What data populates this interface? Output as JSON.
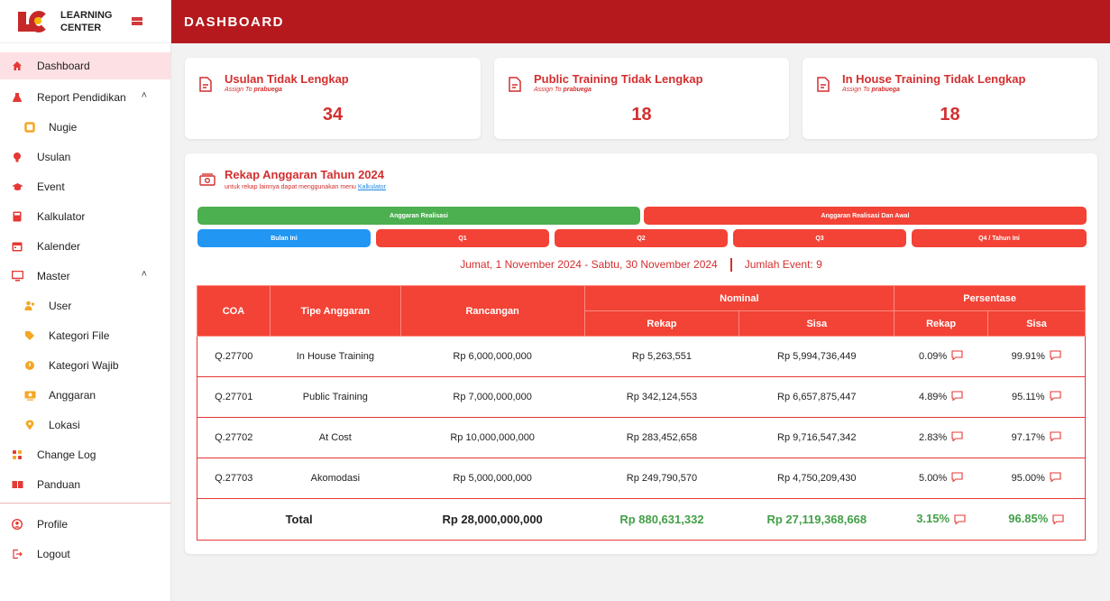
{
  "brand": {
    "line1": "LEARNING",
    "line2": "CENTER"
  },
  "header": {
    "title": "DASHBOARD"
  },
  "sidebar": {
    "items": [
      {
        "label": "Dashboard",
        "icon": "home-icon",
        "active": true
      },
      {
        "label": "Report Pendidikan",
        "icon": "flask-icon",
        "expanded": true
      },
      {
        "label": "Nugie",
        "icon": "book-icon",
        "sub": true
      },
      {
        "label": "Usulan",
        "icon": "bulb-icon"
      },
      {
        "label": "Event",
        "icon": "graduation-cap-icon"
      },
      {
        "label": "Kalkulator",
        "icon": "calculator-icon"
      },
      {
        "label": "Kalender",
        "icon": "calendar-icon"
      },
      {
        "label": "Master",
        "icon": "monitor-icon",
        "expanded": true
      },
      {
        "label": "User",
        "icon": "users-icon",
        "sub": true
      },
      {
        "label": "Kategori File",
        "icon": "tag-icon",
        "sub": true
      },
      {
        "label": "Kategori Wajib",
        "icon": "circle-icon",
        "sub": true
      },
      {
        "label": "Anggaran",
        "icon": "money-icon",
        "sub": true
      },
      {
        "label": "Lokasi",
        "icon": "location-icon",
        "sub": true
      },
      {
        "label": "Change Log",
        "icon": "changelog-icon"
      },
      {
        "label": "Panduan",
        "icon": "guide-book-icon"
      }
    ],
    "bottom": [
      {
        "label": "Profile",
        "icon": "profile-icon"
      },
      {
        "label": "Logout",
        "icon": "logout-icon"
      }
    ]
  },
  "cards": [
    {
      "title": "Usulan Tidak Lengkap",
      "assign_prefix": "Assign To ",
      "assign_user": "prabuega",
      "count": "34"
    },
    {
      "title": "Public Training Tidak Lengkap",
      "assign_prefix": "Assign To ",
      "assign_user": "prabuega",
      "count": "18"
    },
    {
      "title": "In House Training Tidak Lengkap",
      "assign_prefix": "Assign To ",
      "assign_user": "prabuega",
      "count": "18"
    }
  ],
  "rekap": {
    "title": "Rekap Anggaran Tahun 2024",
    "subtitle_prefix": "untuk rekap lainnya dapat menggunakan menu ",
    "subtitle_link": "Kalkulator",
    "tabs_top": [
      "Anggaran Realisasi",
      "Anggaran Realisasi Dan Awal"
    ],
    "tabs_period": [
      "Bulan Ini",
      "Q1",
      "Q2",
      "Q3",
      "Q4 / Tahun Ini"
    ],
    "period_text": "Jumat, 1 November 2024 - Sabtu, 30 November 2024",
    "event_text": "Jumlah Event: 9"
  },
  "colors": {
    "primary": "#b5191d",
    "accent": "#f24336",
    "green": "#4caf50",
    "blue": "#2196f3"
  },
  "table": {
    "headers": {
      "coa": "COA",
      "tipe": "Tipe Anggaran",
      "rancangan": "Rancangan",
      "nominal": "Nominal",
      "persentase": "Persentase",
      "rekap": "Rekap",
      "sisa": "Sisa",
      "rekap2": "Rekap",
      "sisa2": "Sisa"
    },
    "rows": [
      {
        "coa": "Q.27700",
        "tipe": "In House Training",
        "rancangan": "Rp 6,000,000,000",
        "rekap": "Rp 5,263,551",
        "sisa": "Rp 5,994,736,449",
        "p_rekap": "0.09%",
        "p_sisa": "99.91%"
      },
      {
        "coa": "Q.27701",
        "tipe": "Public Training",
        "rancangan": "Rp 7,000,000,000",
        "rekap": "Rp 342,124,553",
        "sisa": "Rp 6,657,875,447",
        "p_rekap": "4.89%",
        "p_sisa": "95.11%"
      },
      {
        "coa": "Q.27702",
        "tipe": "At Cost",
        "rancangan": "Rp 10,000,000,000",
        "rekap": "Rp 283,452,658",
        "sisa": "Rp 9,716,547,342",
        "p_rekap": "2.83%",
        "p_sisa": "97.17%"
      },
      {
        "coa": "Q.27703",
        "tipe": "Akomodasi",
        "rancangan": "Rp 5,000,000,000",
        "rekap": "Rp 249,790,570",
        "sisa": "Rp 4,750,209,430",
        "p_rekap": "5.00%",
        "p_sisa": "95.00%"
      }
    ],
    "total": {
      "label": "Total",
      "rancangan": "Rp 28,000,000,000",
      "rekap": "Rp 880,631,332",
      "sisa": "Rp 27,119,368,668",
      "p_rekap": "3.15%",
      "p_sisa": "96.85%"
    }
  }
}
